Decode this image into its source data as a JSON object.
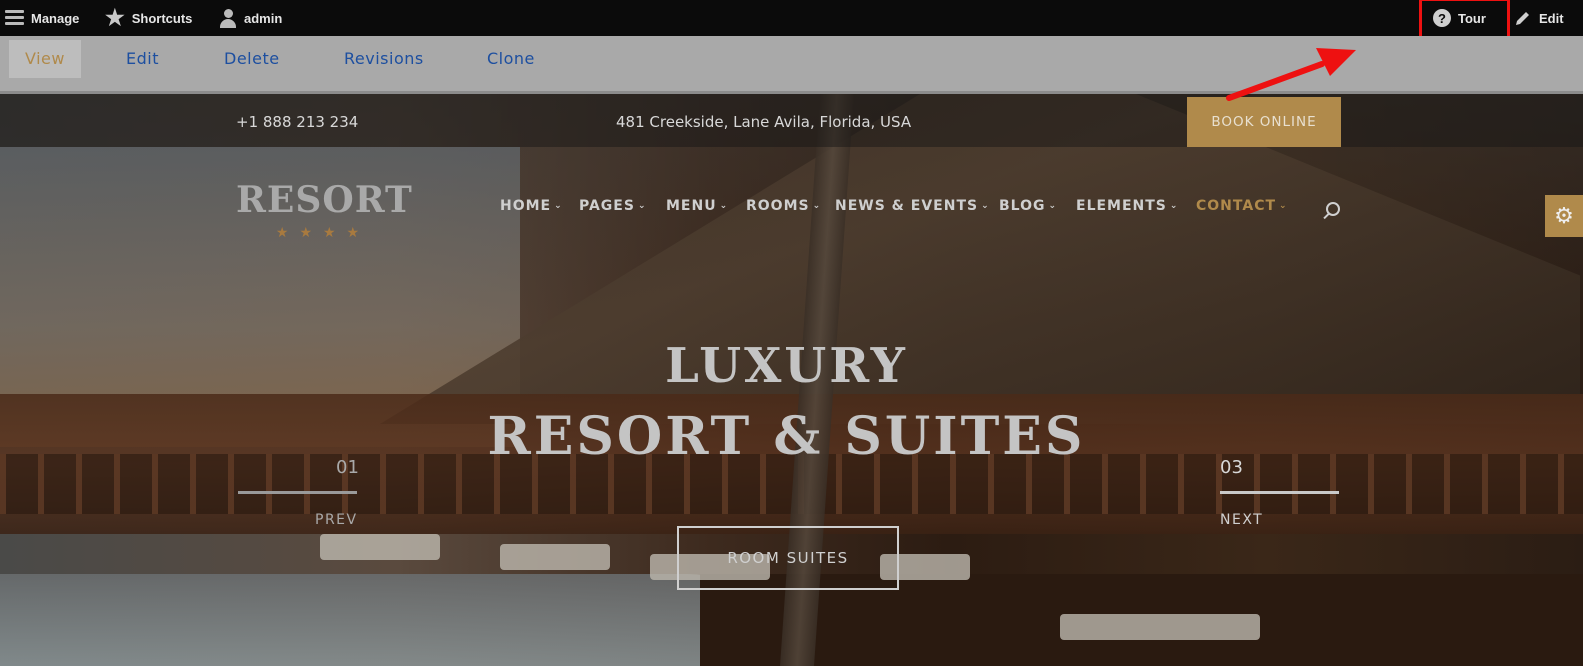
{
  "toolbar": {
    "manage": "Manage",
    "shortcuts": "Shortcuts",
    "user": "admin",
    "tour": "Tour",
    "edit": "Edit"
  },
  "tabs": [
    "View",
    "Edit",
    "Delete",
    "Revisions",
    "Clone"
  ],
  "site": {
    "phone": "+1 888 213 234",
    "address": "481 Creekside, Lane Avila, Florida, USA",
    "book_online": "BOOK ONLINE",
    "logo": "RESORT",
    "logo_stars": "★★★★",
    "nav": [
      "HOME",
      "PAGES",
      "MENU",
      "ROOMS",
      "NEWS & EVENTS",
      "BLOG",
      "ELEMENTS",
      "CONTACT"
    ]
  },
  "hero": {
    "line1": "LUXURY",
    "line2": "RESORT & SUITES",
    "prev_num": "01",
    "prev_label": "PREV",
    "next_num": "03",
    "next_label": "NEXT",
    "cta": "ROOM SUITES"
  },
  "colors": {
    "accent": "#b08a4b",
    "highlight": "#ee1111",
    "link": "#1d4fa0"
  },
  "icons": {
    "manage": "hamburger-icon",
    "shortcuts": "star-icon",
    "user": "person-icon",
    "tour": "question-icon",
    "edit": "pencil-icon",
    "search": "search-icon",
    "settings": "gear-icon"
  }
}
